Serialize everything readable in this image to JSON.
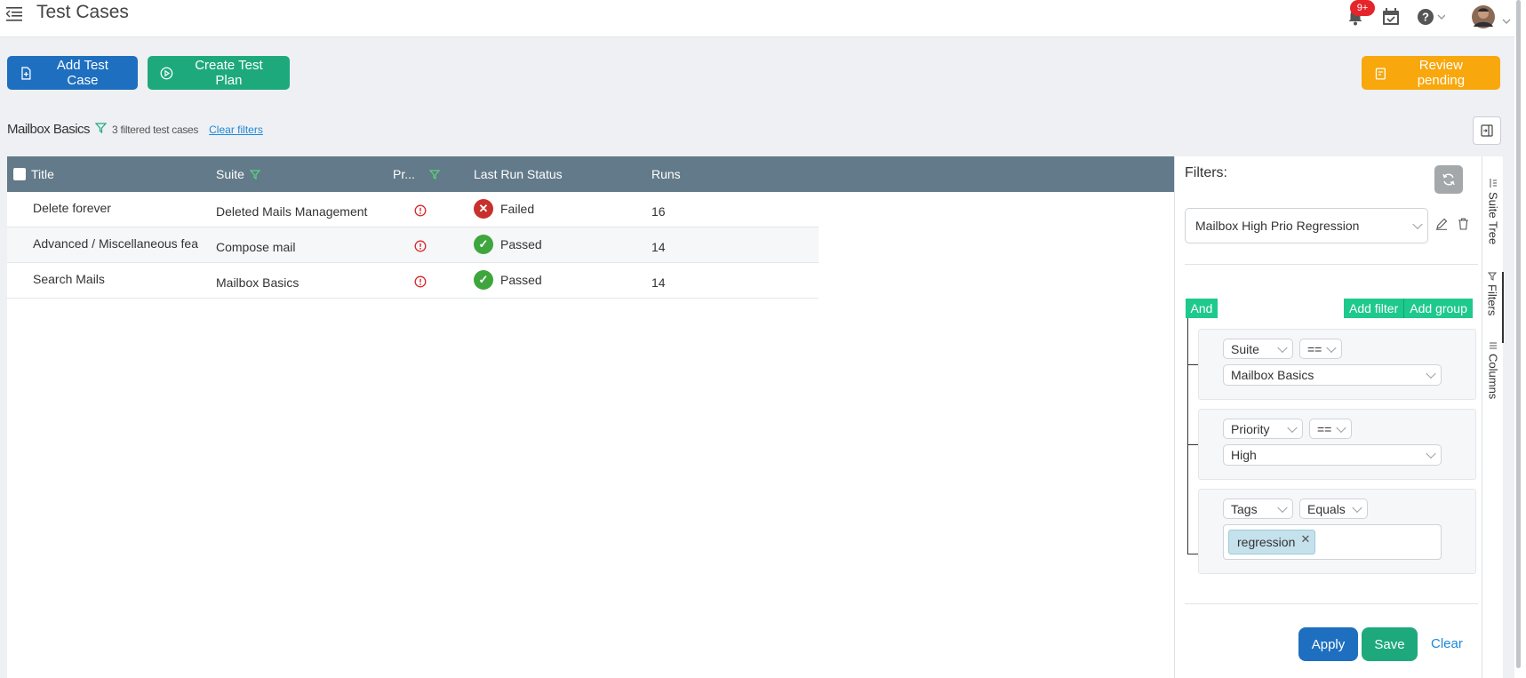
{
  "header": {
    "title": "Test Cases",
    "notifications_badge": "9+"
  },
  "actions": {
    "add_test_case": "Add Test Case",
    "create_test_plan": "Create Test Plan",
    "review_pending": "Review pending"
  },
  "breadcrumb": {
    "title": "Mailbox Basics",
    "count": "3 filtered test cases",
    "clear_filters": "Clear filters"
  },
  "table": {
    "columns": [
      "Title",
      "Suite",
      "Pr...",
      "Last Run Status",
      "Runs"
    ],
    "rows": [
      {
        "title": "Delete forever",
        "suite": "Deleted Mails Management",
        "status": "Failed",
        "runs": "16"
      },
      {
        "title": "Advanced / Miscellaneous fea",
        "suite": "Compose mail",
        "status": "Passed",
        "runs": "14"
      },
      {
        "title": "Search Mails",
        "suite": "Mailbox Basics",
        "status": "Passed",
        "runs": "14"
      }
    ]
  },
  "filters": {
    "label": "Filters:",
    "saved_filter": "Mailbox High Prio Regression",
    "combinator": "And",
    "add_filter": "Add filter",
    "add_group": "Add group",
    "rules": [
      {
        "field": "Suite",
        "operator": "==",
        "value": "Mailbox Basics"
      },
      {
        "field": "Priority",
        "operator": "==",
        "value": "High"
      },
      {
        "field": "Tags",
        "operator": "Equals",
        "value": "regression"
      }
    ],
    "apply": "Apply",
    "save": "Save",
    "clear": "Clear"
  },
  "side_tabs": [
    "Suite Tree",
    "Filters",
    "Columns"
  ],
  "colors": {
    "primary_blue": "#1e6fbf",
    "green": "#1ea97c",
    "orange": "#f8a70c",
    "header_gray": "#627a89",
    "failed_red": "#c8302d",
    "passed_green": "#3ea63c"
  }
}
